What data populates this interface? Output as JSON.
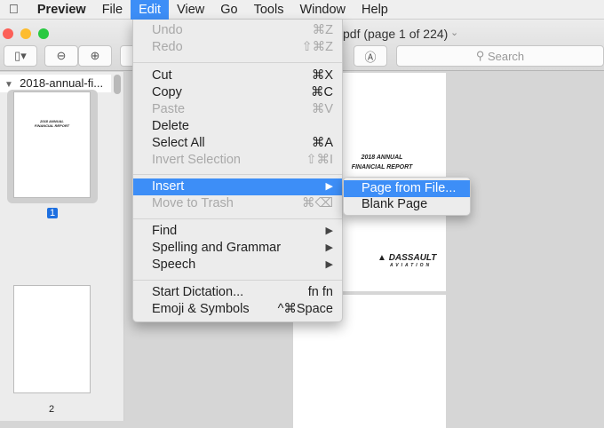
{
  "menubar": {
    "items": [
      "Preview",
      "File",
      "Edit",
      "View",
      "Go",
      "Tools",
      "Window",
      "Help"
    ]
  },
  "window": {
    "title": "pdf (page 1 of 224)",
    "search_placeholder": "Search"
  },
  "sidebar": {
    "document": "2018-annual-fi...",
    "pages": [
      {
        "label": "1",
        "title_line1": "2018 ANNUAL",
        "title_line2": "FINANCIAL REPORT"
      },
      {
        "label": "2"
      }
    ]
  },
  "document": {
    "title_line1": "2018 ANNUAL",
    "title_line2": "FINANCIAL REPORT",
    "logo": "DASSAULT",
    "logo_sub": "AVIATION"
  },
  "edit_menu": {
    "items": [
      {
        "label": "Undo",
        "shortcut": "⌘Z",
        "enabled": false
      },
      {
        "label": "Redo",
        "shortcut": "⇧⌘Z",
        "enabled": false
      },
      {
        "label": "Cut",
        "shortcut": "⌘X",
        "enabled": true
      },
      {
        "label": "Copy",
        "shortcut": "⌘C",
        "enabled": true
      },
      {
        "label": "Paste",
        "shortcut": "⌘V",
        "enabled": false
      },
      {
        "label": "Delete",
        "shortcut": "",
        "enabled": true
      },
      {
        "label": "Select All",
        "shortcut": "⌘A",
        "enabled": true
      },
      {
        "label": "Invert Selection",
        "shortcut": "⇧⌘I",
        "enabled": false
      },
      {
        "label": "Insert",
        "shortcut": "▶",
        "enabled": true
      },
      {
        "label": "Move to Trash",
        "shortcut": "⌘⌫",
        "enabled": false
      },
      {
        "label": "Find",
        "shortcut": "▶",
        "enabled": true
      },
      {
        "label": "Spelling and Grammar",
        "shortcut": "▶",
        "enabled": true
      },
      {
        "label": "Speech",
        "shortcut": "▶",
        "enabled": true
      },
      {
        "label": "Start Dictation...",
        "shortcut": "fn fn",
        "enabled": true
      },
      {
        "label": "Emoji & Symbols",
        "shortcut": "^⌘Space",
        "enabled": true
      }
    ]
  },
  "insert_submenu": {
    "items": [
      "Page from File...",
      "Blank Page"
    ]
  }
}
